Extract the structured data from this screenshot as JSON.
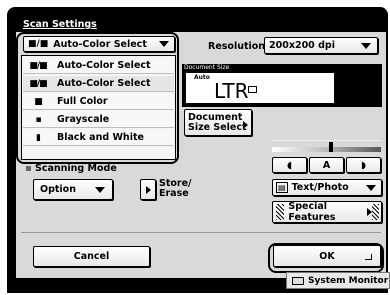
{
  "title": "Scan Settings",
  "color_select": {
    "selected": "Auto-Color Select"
  },
  "dropdown": {
    "items": [
      {
        "icon": "color-bw-icon",
        "label": "Auto-Color Select"
      },
      {
        "icon": "color-bw-icon",
        "label": "Auto-Color Select"
      },
      {
        "icon": "full-color-icon",
        "label": "Full Color"
      },
      {
        "icon": "grayscale-icon",
        "label": "Grayscale"
      },
      {
        "icon": "black-white-icon",
        "label": "Black and White"
      }
    ]
  },
  "resolution": {
    "label": "Resolution:",
    "value": "200x200 dpi"
  },
  "document_size": {
    "label": "Document Size",
    "auto": "Auto",
    "value": "LTR"
  },
  "buttons": {
    "doc_size_line1": "Document",
    "doc_size_line2": "Size Select",
    "density_light": "◖",
    "density_auto": "A",
    "density_dark": "◗",
    "text_photo": "Text/Photo",
    "special_features": "Special Features",
    "store_erase_line1": "Store/",
    "store_erase_line2": "Erase",
    "option": "Option",
    "cancel": "Cancel",
    "ok": "OK",
    "system_monitor": "System Monitor"
  },
  "scanning_mode": {
    "label": "Scanning Mode"
  }
}
